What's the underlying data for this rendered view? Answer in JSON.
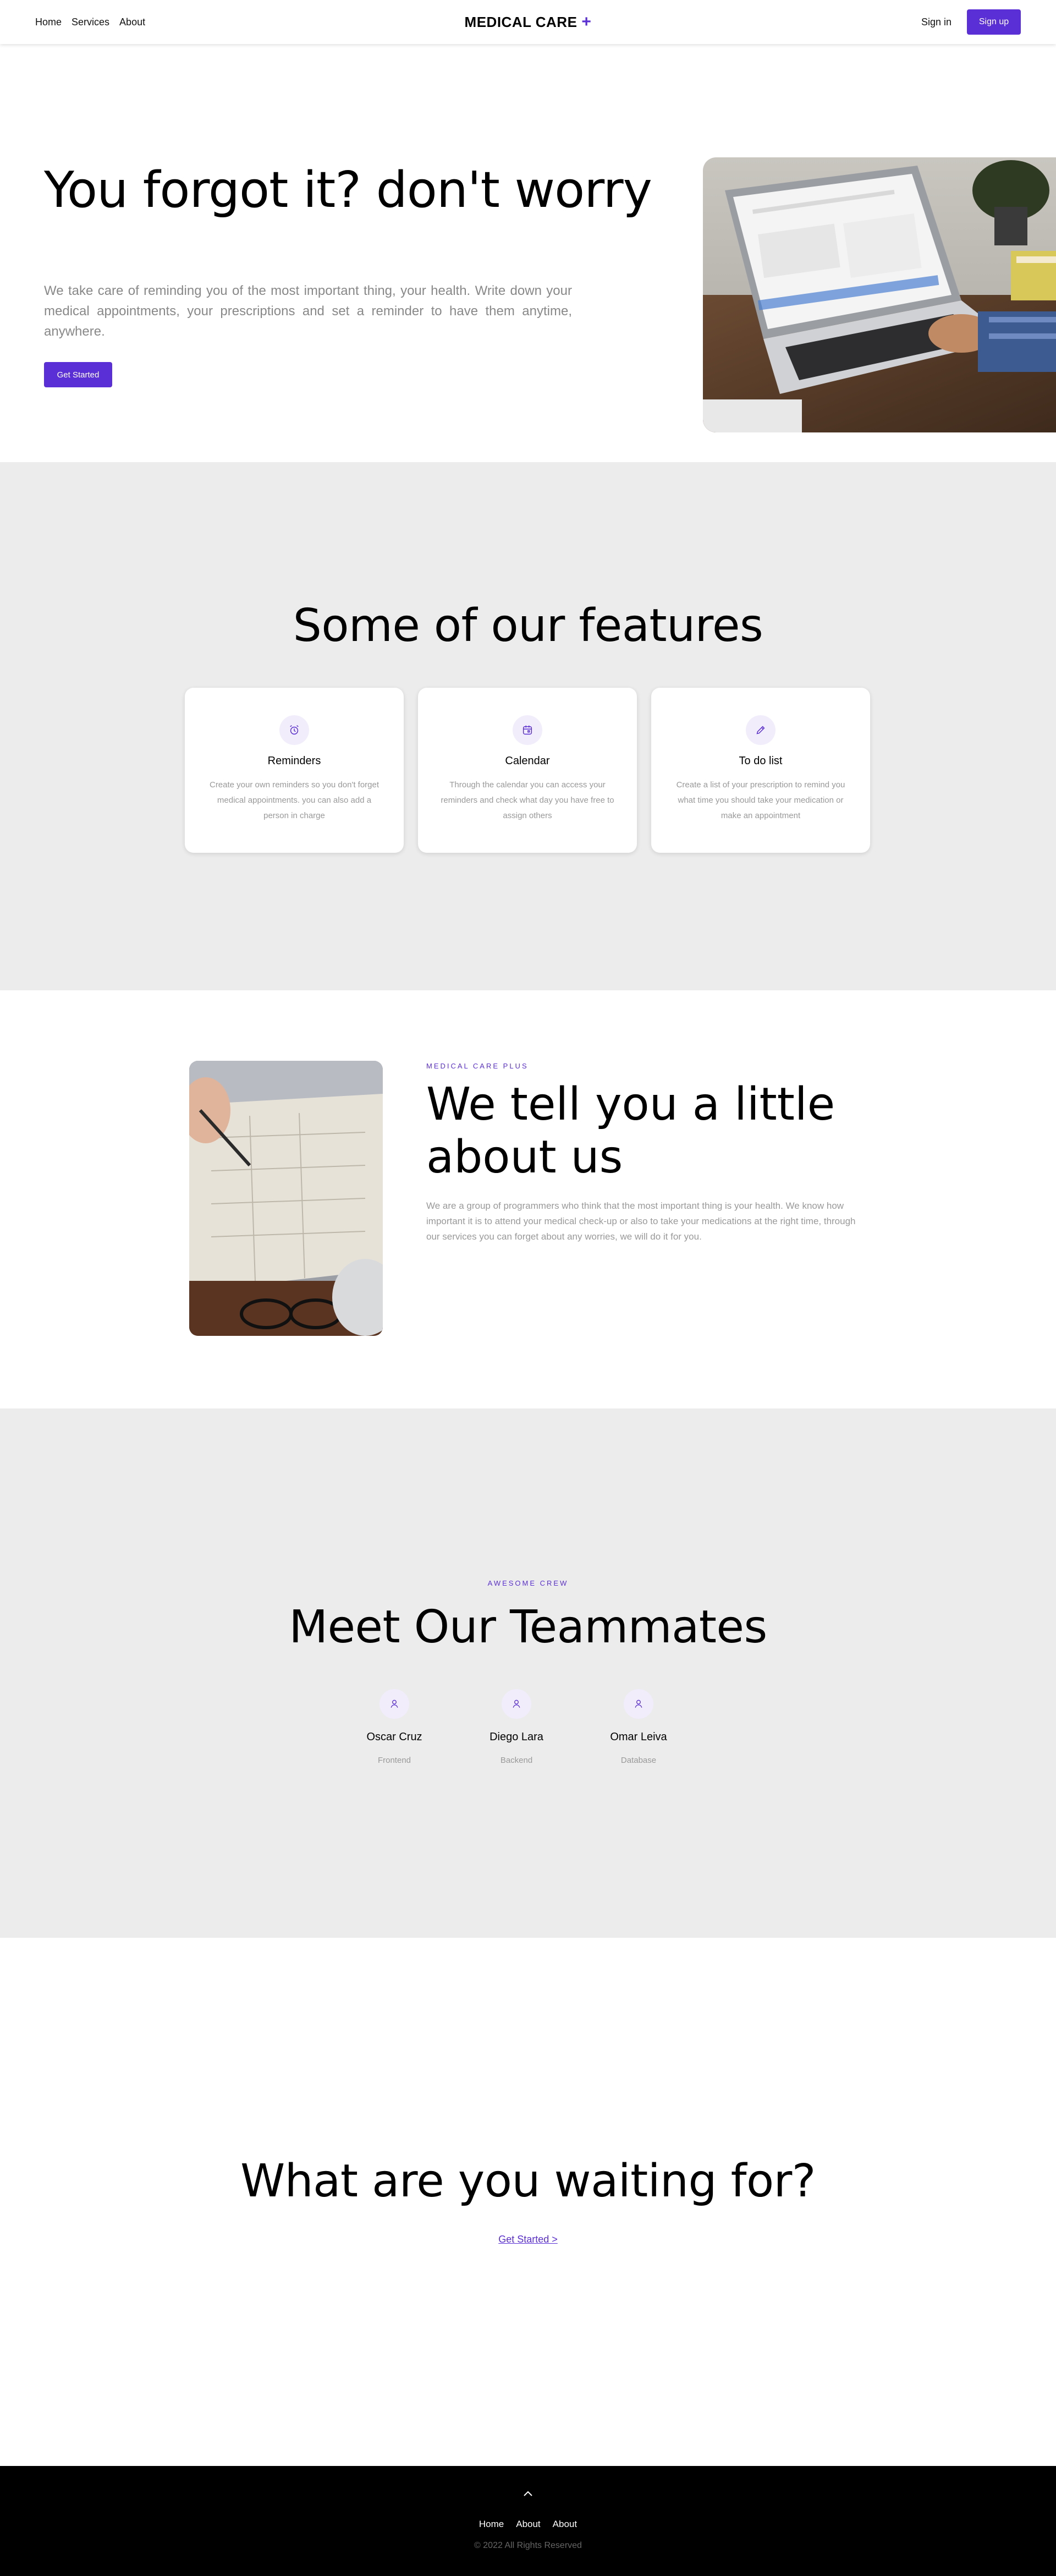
{
  "nav": {
    "links": [
      "Home",
      "Services",
      "About"
    ],
    "brand": "MEDICAL CARE",
    "brand_symbol": "+",
    "signin": "Sign in",
    "signup": "Sign up"
  },
  "hero": {
    "title": "You forgot it? don't worry",
    "text": "We take care of reminding you of the most important thing, your health. Write down your medical appointments, your prescriptions and set a reminder to have them anytime, anywhere.",
    "button": "Get Started"
  },
  "features": {
    "title": "Some of our features",
    "cards": [
      {
        "icon": "alarm-clock-icon",
        "title": "Reminders",
        "text": "Create your own reminders so you don't forget medical appointments. you can also add a person in charge"
      },
      {
        "icon": "calendar-icon",
        "title": "Calendar",
        "text": "Through the calendar you can access your reminders and check what day you have free to assign others"
      },
      {
        "icon": "pencil-icon",
        "title": "To do list",
        "text": "Create a list of your prescription to remind you what time you should take your medication or make an appointment"
      }
    ]
  },
  "about": {
    "eyebrow": "MEDICAL CARE PLUS",
    "title": "We tell you a little about us",
    "text": "We are a group of programmers who think that the most important thing is your health. We know how important it is to attend your medical check-up or also to take your medications at the right time, through our services you can forget about any worries, we will do it for you."
  },
  "team": {
    "eyebrow": "AWESOME CREW",
    "title": "Meet Our Teammates",
    "members": [
      {
        "name": "Oscar Cruz",
        "role": "Frontend",
        "icon": "user-icon"
      },
      {
        "name": "Diego Lara",
        "role": "Backend",
        "icon": "user-icon"
      },
      {
        "name": "Omar Leiva",
        "role": "Database",
        "icon": "user-icon"
      }
    ]
  },
  "cta": {
    "title": "What are you waiting for?",
    "link": "Get Started >"
  },
  "footer": {
    "up_icon": "chevron-up-icon",
    "links": [
      "Home",
      "About",
      "About"
    ],
    "copyright": "© 2022 All Rights Reserved"
  },
  "colors": {
    "accent": "#5b2fd6",
    "section_gray": "#ececec",
    "muted_text": "#999999",
    "footer_bg": "#000000"
  }
}
